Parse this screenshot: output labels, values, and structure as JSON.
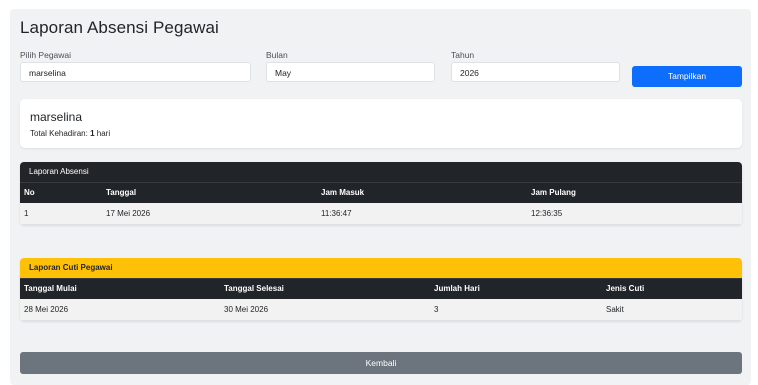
{
  "page": {
    "title": "Laporan Absensi Pegawai"
  },
  "filters": {
    "employee": {
      "label": "Pilih Pegawai",
      "value": "marselina"
    },
    "month": {
      "label": "Bulan",
      "value": "May"
    },
    "year": {
      "label": "Tahun",
      "value": "2026"
    },
    "submit_label": "Tampilkan"
  },
  "summary": {
    "name": "marselina",
    "total_label": "Total Kehadiran:",
    "total_value": "1",
    "total_unit": "hari"
  },
  "attendance": {
    "title": "Laporan Absensi",
    "columns": [
      "No",
      "Tanggal",
      "Jam Masuk",
      "Jam Pulang"
    ],
    "rows": [
      {
        "no": "1",
        "date": "17 Mei 2026",
        "in": "11:36:47",
        "out": "12:36:35"
      }
    ]
  },
  "leave": {
    "title": "Laporan Cuti Pegawai",
    "columns": [
      "Tanggal Mulai",
      "Tanggal Selesai",
      "Jumlah Hari",
      "Jenis Cuti"
    ],
    "rows": [
      {
        "start": "28 Mei 2026",
        "end": "30 Mei 2026",
        "days": "3",
        "type": "Sakit"
      }
    ]
  },
  "back_label": "Kembali",
  "colors": {
    "primary": "#0d6efd",
    "dark": "#212529",
    "warning": "#ffc107",
    "secondary": "#6c757d"
  }
}
